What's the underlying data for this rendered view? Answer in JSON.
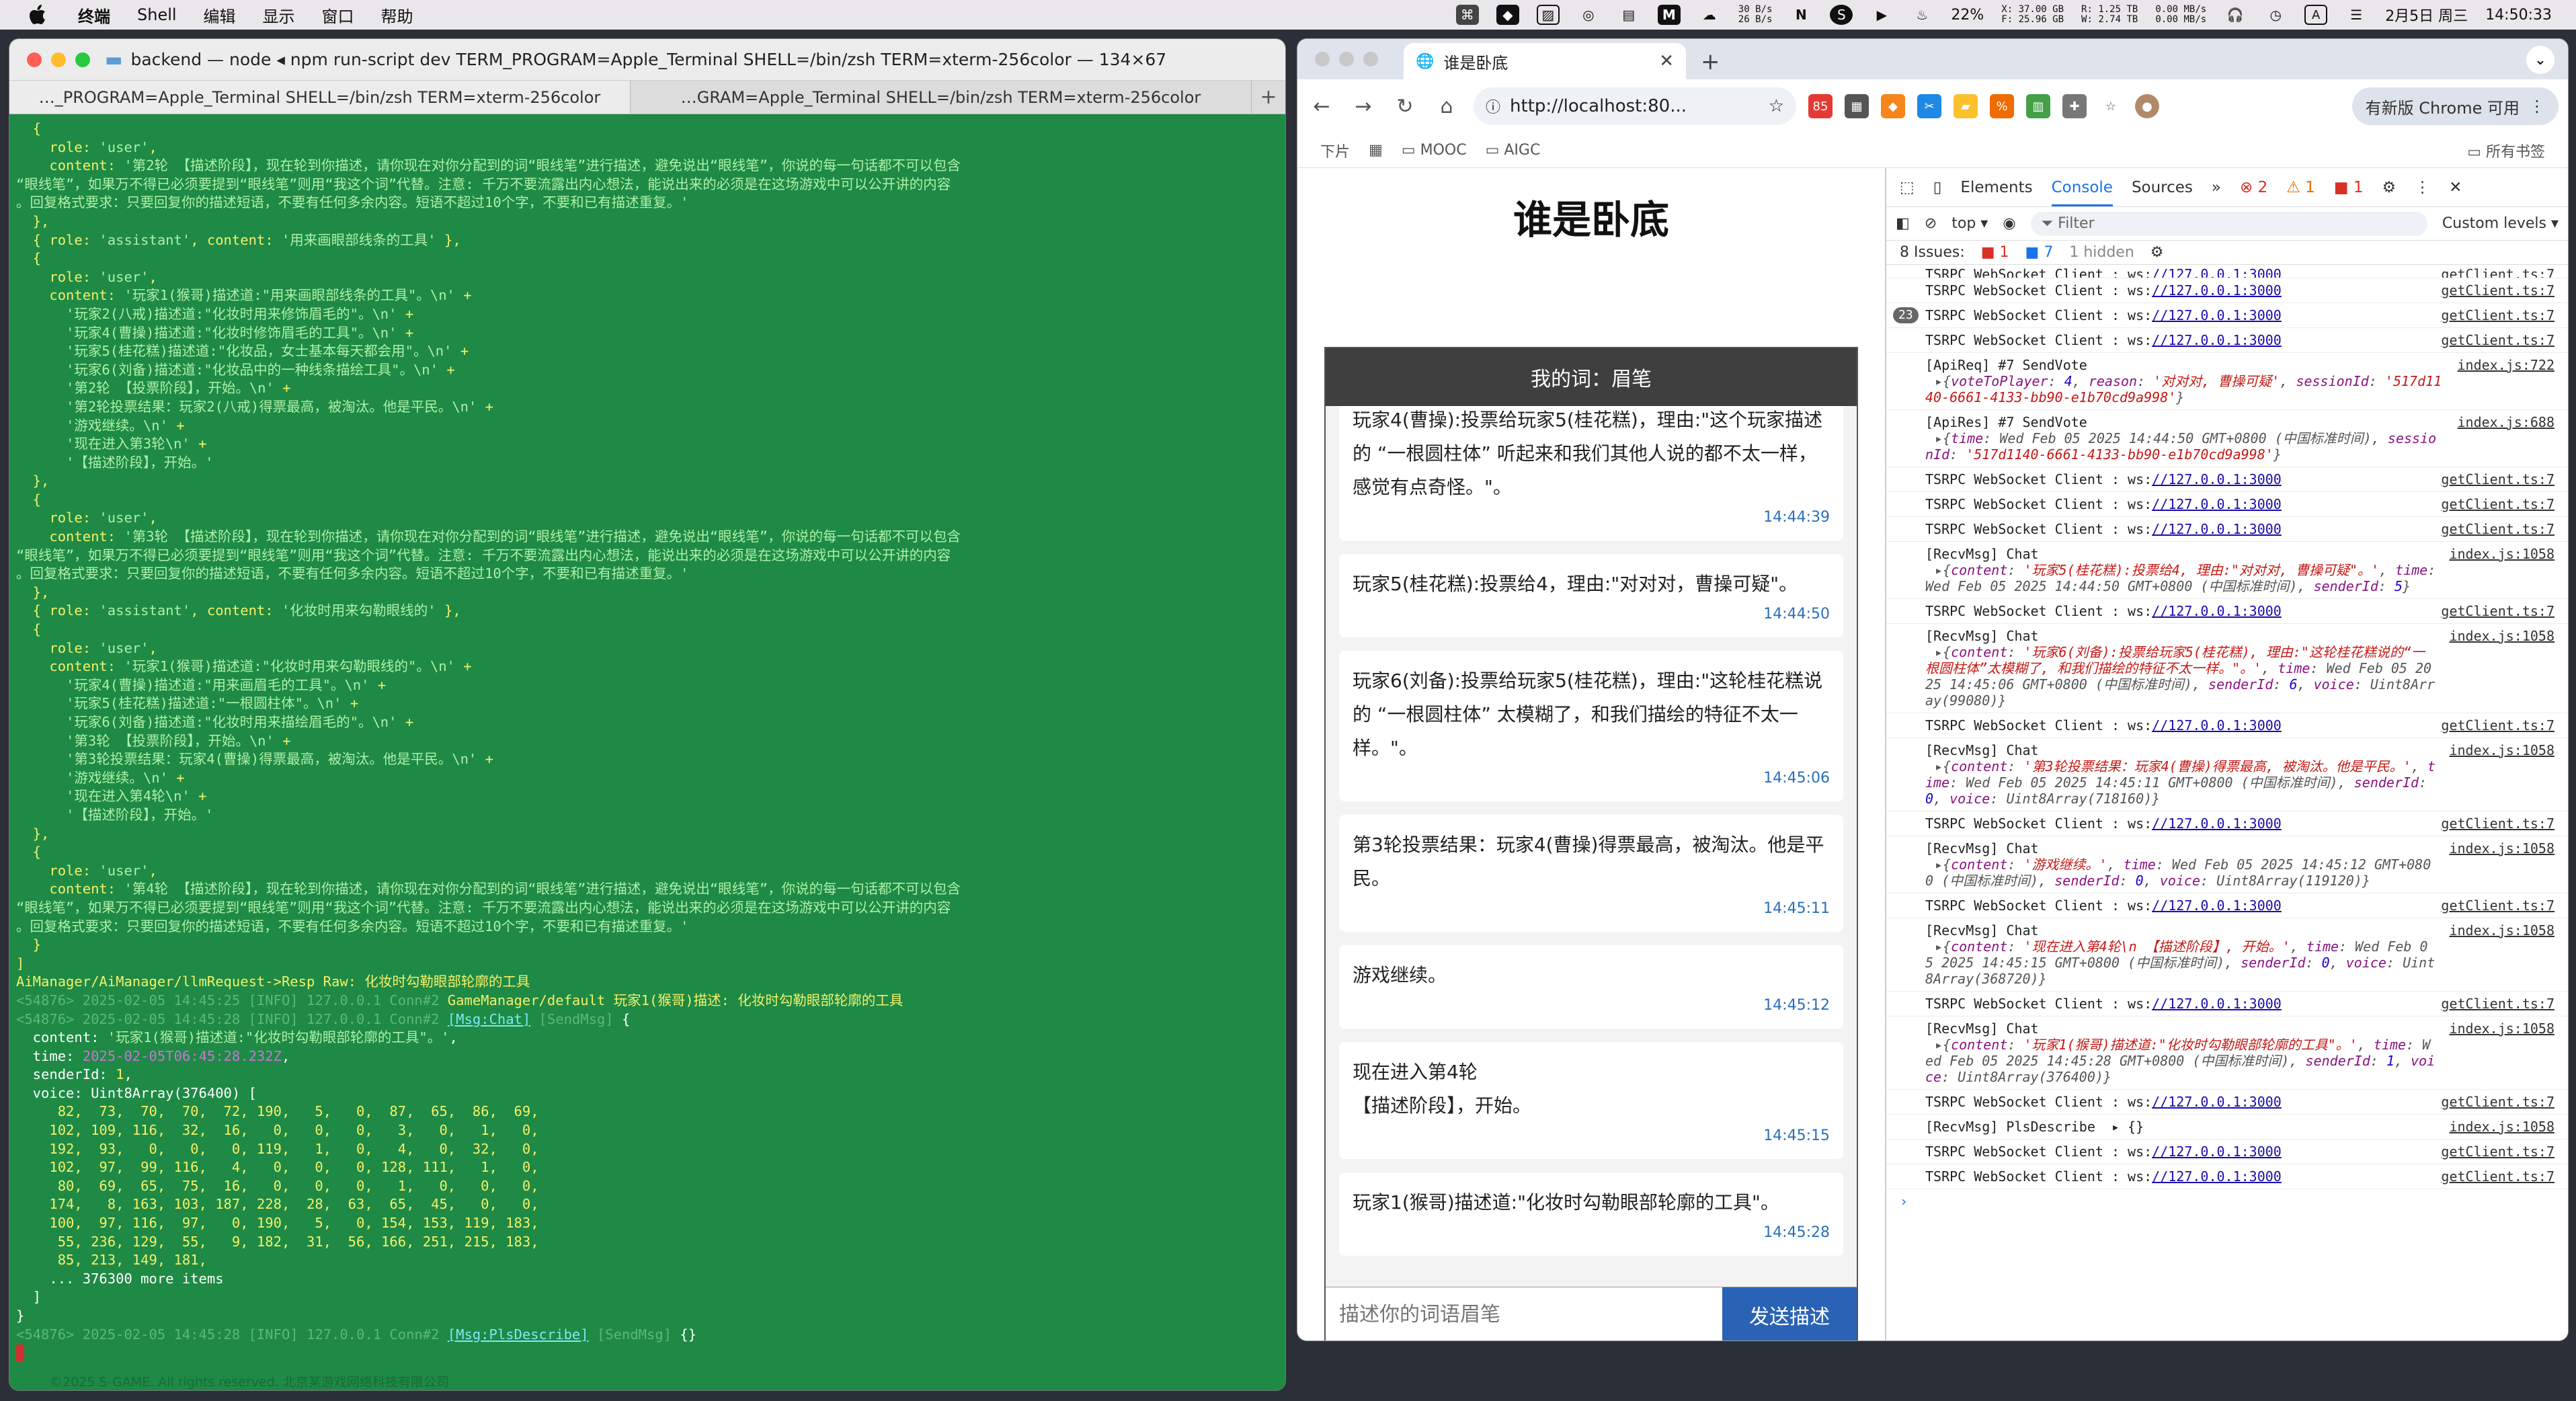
{
  "menubar": {
    "app": "终端",
    "items": [
      "Shell",
      "编辑",
      "显示",
      "窗口",
      "帮助"
    ],
    "net_up": "30 B/s",
    "net_down": "26 B/s",
    "cpu": "22%",
    "disk_x": "37.00 GB",
    "disk_f": "25.96 GB",
    "disk_r": "1.25 TB",
    "disk_w": "2.74 TB",
    "io_1": "0.00 MB/s",
    "io_2": "0.00 MB/s",
    "ime": "A",
    "date": "2月5日 周三",
    "time": "14:50:33"
  },
  "terminal": {
    "title": "backend — node ◂ npm run-script dev TERM_PROGRAM=Apple_Terminal SHELL=/bin/zsh TERM=xterm-256color — 134×67",
    "tab1": "…_PROGRAM=Apple_Terminal SHELL=/bin/zsh TERM=xterm-256color",
    "tab2": "…GRAM=Apple_Terminal SHELL=/bin/zsh TERM=xterm-256color",
    "footer": "©2025 S-GAME. All rights reserved. 北京某游戏网络科技有限公司"
  },
  "chrome": {
    "tab_title": "谁是卧底",
    "url": "http://localhost:80...",
    "update_label": "有新版 Chrome 可用",
    "bookmarks": [
      "下片",
      "MOOC",
      "AIGC"
    ],
    "all_bookmarks": "所有书签"
  },
  "game": {
    "title": "谁是卧底",
    "my_word": "我的词：眉笔",
    "input_placeholder": "描述你的词语眉笔",
    "send_label": "发送描述",
    "messages": [
      {
        "text": "玩家4(曹操):投票给玩家5(桂花糕)，理由:\"这个玩家描述的 “一根圆柱体” 听起来和我们其他人说的都不太一样，感觉有点奇怪。\"。",
        "time": "14:44:39"
      },
      {
        "text": "玩家5(桂花糕):投票给4，理由:\"对对对，曹操可疑\"。",
        "time": "14:44:50"
      },
      {
        "text": "玩家6(刘备):投票给玩家5(桂花糕)，理由:\"这轮桂花糕说的 “一根圆柱体” 太模糊了，和我们描绘的特征不太一样。\"。",
        "time": "14:45:06"
      },
      {
        "text": "第3轮投票结果：玩家4(曹操)得票最高，被淘汰。他是平民。",
        "time": "14:45:11"
      },
      {
        "text": "游戏继续。",
        "time": "14:45:12"
      },
      {
        "text": "现在进入第4轮\n【描述阶段】，开始。",
        "time": "14:45:15"
      },
      {
        "text": "玩家1(猴哥)描述道:\"化妆时勾勒眼部轮廓的工具\"。",
        "time": "14:45:28"
      }
    ]
  },
  "devtools": {
    "tabs": [
      "Elements",
      "Console",
      "Sources"
    ],
    "errors": "2",
    "warnings": "1",
    "info": "1",
    "context": "top",
    "filter_placeholder": "Filter",
    "levels": "Custom levels",
    "issues": "8 Issues:",
    "issue_err": "1",
    "issue_info": "7",
    "hidden": "1 hidden"
  }
}
